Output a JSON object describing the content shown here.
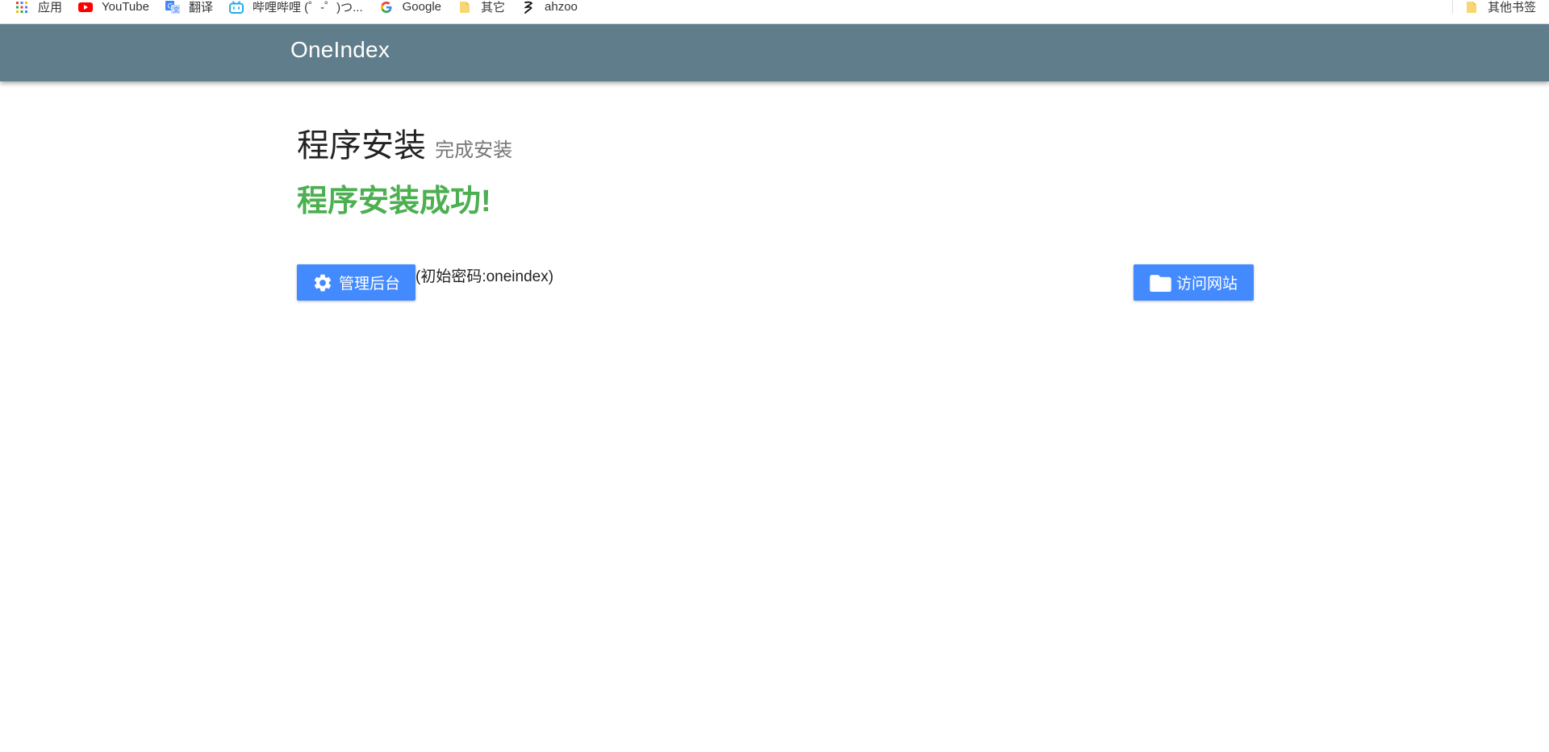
{
  "bookmarks": {
    "items": [
      {
        "label": "应用",
        "icon": "apps-grid-icon"
      },
      {
        "label": "YouTube",
        "icon": "youtube-icon"
      },
      {
        "label": "翻译",
        "icon": "google-translate-icon"
      },
      {
        "label": "哔哩哔哩 (゜-゜)つ...",
        "icon": "bilibili-icon"
      },
      {
        "label": "Google",
        "icon": "google-icon"
      },
      {
        "label": "其它",
        "icon": "folder-icon"
      },
      {
        "label": "ahzoo",
        "icon": "ahzoo-icon"
      }
    ],
    "other": {
      "label": "其他书签",
      "icon": "folder-icon"
    }
  },
  "header": {
    "title": "OneIndex"
  },
  "main": {
    "title": "程序安装",
    "subtitle": "完成安装",
    "success_message": "程序安装成功!",
    "admin_button": {
      "label": "管理后台",
      "icon": "gear-icon"
    },
    "password_hint": "(初始密码:oneindex)",
    "visit_button": {
      "label": "访问网站",
      "icon": "folder-icon"
    }
  },
  "colors": {
    "header_bg": "#607d8b",
    "accent": "#448aff",
    "success": "#4caf50"
  }
}
